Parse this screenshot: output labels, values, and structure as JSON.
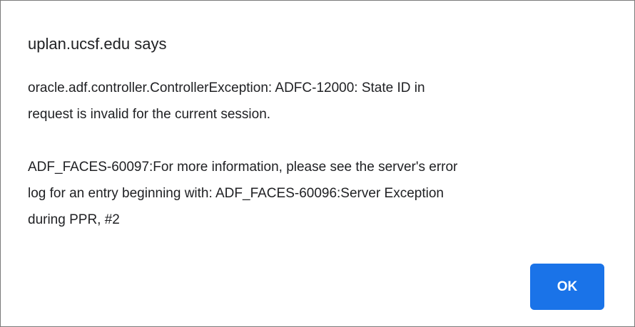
{
  "dialog": {
    "origin_title": "uplan.ucsf.edu says",
    "message_lines": [
      "oracle.adf.controller.ControllerException: ADFC-12000: State ID in",
      "request is invalid for the current session.",
      "ADF_FACES-60097:For more information, please see the server's error",
      "log for an entry beginning with: ADF_FACES-60096:Server Exception",
      "during PPR, #2"
    ],
    "ok_label": "OK"
  },
  "colors": {
    "button_background": "#1a73e8",
    "button_text": "#ffffff",
    "text": "#202124",
    "border": "#7a7a7a"
  }
}
